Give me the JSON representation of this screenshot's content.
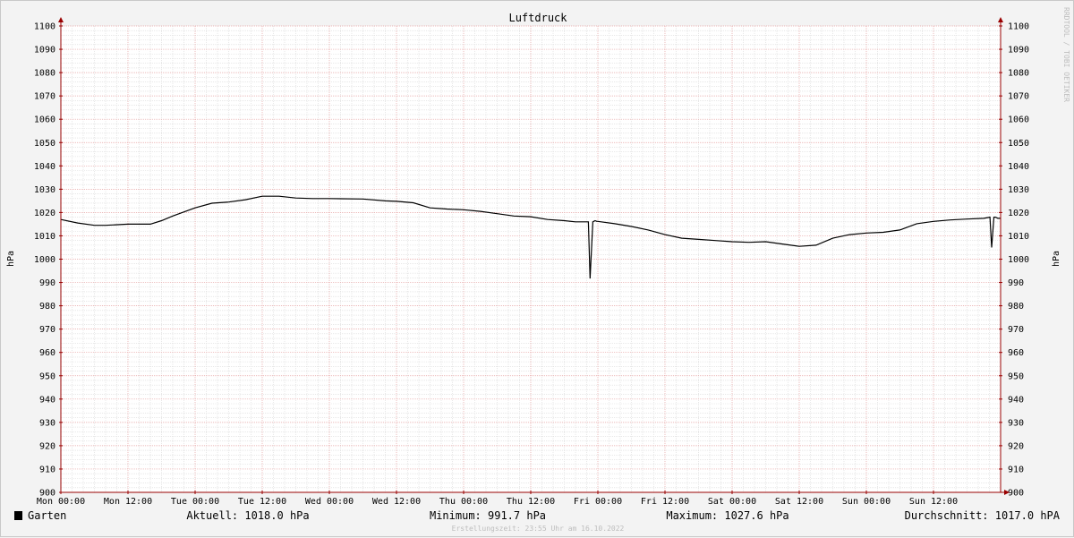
{
  "chart_data": {
    "type": "line",
    "title": "Luftdruck",
    "ylabel_left": "hPa",
    "ylabel_right": "hPa",
    "ylim": [
      900,
      1100
    ],
    "y_ticks": [
      900,
      910,
      920,
      930,
      940,
      950,
      960,
      970,
      980,
      990,
      1000,
      1010,
      1020,
      1030,
      1040,
      1050,
      1060,
      1070,
      1080,
      1090,
      1100
    ],
    "x_tick_labels": [
      "Mon 00:00",
      "Mon 12:00",
      "Tue 00:00",
      "Tue 12:00",
      "Wed 00:00",
      "Wed 12:00",
      "Thu 00:00",
      "Thu 12:00",
      "Fri 00:00",
      "Fri 12:00",
      "Sat 00:00",
      "Sat 12:00",
      "Sun 00:00",
      "Sun 12:00"
    ],
    "xlim_hours": [
      0,
      168
    ],
    "grid": true,
    "series": [
      {
        "name": "Garten",
        "color": "#000000",
        "x_hours": [
          0,
          3,
          6,
          8,
          12,
          15,
          16,
          18,
          20,
          24,
          27,
          30,
          33,
          36,
          39,
          42,
          45,
          48,
          54,
          58,
          60,
          63,
          66,
          69,
          72,
          75,
          78,
          81,
          84,
          87,
          90,
          92,
          94.3,
          94.6,
          95.1,
          95.5,
          95.8,
          96,
          99,
          102,
          105,
          108,
          111,
          114,
          117,
          120,
          123,
          126,
          129,
          132,
          135,
          138,
          141,
          144,
          147,
          150,
          153,
          156,
          159,
          162,
          165,
          166.1,
          166.4,
          166.8,
          167.1,
          167.5,
          168
        ],
        "values": [
          1017,
          1015.5,
          1014.5,
          1014.5,
          1015,
          1015,
          1015,
          1016.5,
          1018.5,
          1022,
          1024,
          1024.5,
          1025.5,
          1027,
          1027,
          1026.2,
          1026,
          1026,
          1025.8,
          1025,
          1024.8,
          1024.2,
          1022,
          1021.5,
          1021.2,
          1020.5,
          1019.5,
          1018.5,
          1018.2,
          1017,
          1016.5,
          1016,
          1016,
          991.7,
          1016,
          1016.5,
          1016.2,
          1016.2,
          1015.2,
          1014,
          1012.5,
          1010.5,
          1009,
          1008.5,
          1008,
          1007.5,
          1007.2,
          1007.5,
          1006.5,
          1005.5,
          1006,
          1009,
          1010.5,
          1011.2,
          1011.5,
          1012.5,
          1015.2,
          1016.2,
          1016.8,
          1017.2,
          1017.5,
          1018,
          1005,
          1018,
          1018,
          1017.5,
          1017.5
        ]
      }
    ]
  },
  "footer": {
    "legend_label": "Garten",
    "legend_color": "#000000",
    "current": "Aktuell: 1018.0 hPa",
    "minimum": "Minimum: 991.7 hPa",
    "maximum": "Maximum: 1027.6 hPa",
    "average": "Durchschnitt: 1017.0 hPA",
    "created": "Erstellungszeit: 23:55 Uhr am 16.10.2022"
  },
  "credit": "RRDTOOL / TOBI OETIKER",
  "colors": {
    "background": "#f3f3f3",
    "plot_background": "#ffffff",
    "major_grid": "#e6a0a0",
    "minor_grid": "#d9d9d9",
    "axis": "#990000",
    "line": "#000000"
  }
}
